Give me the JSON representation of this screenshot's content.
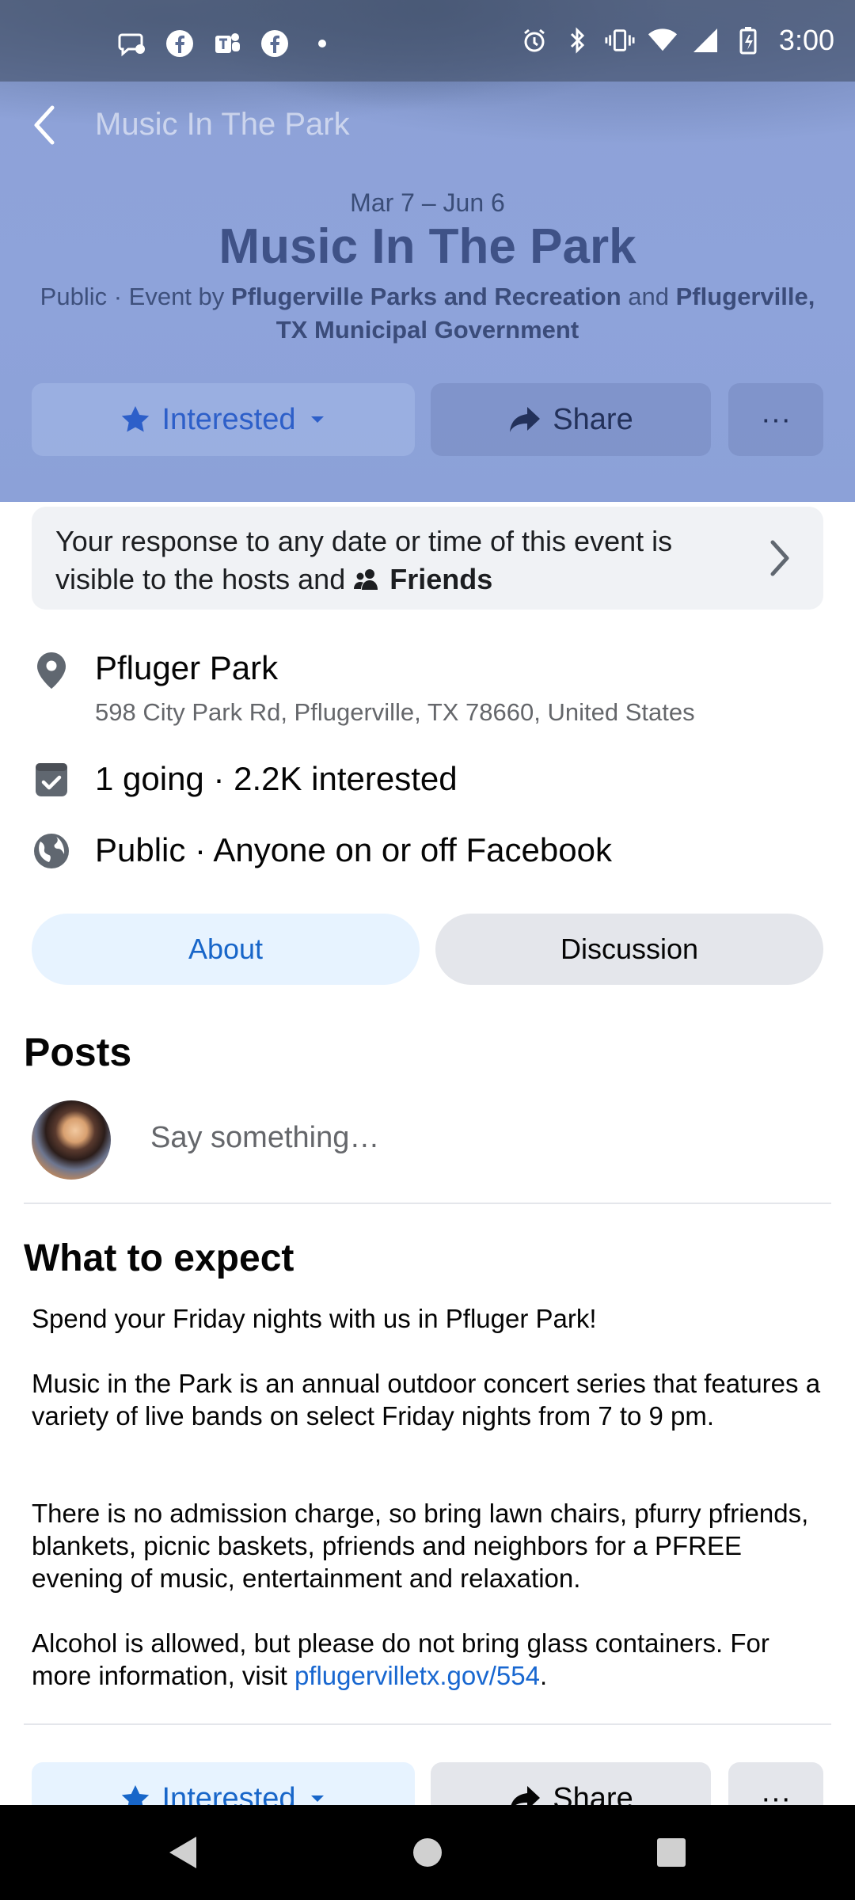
{
  "status_bar": {
    "time": "3:00",
    "left_icons": [
      "messenger-notification-icon",
      "facebook-icon",
      "teams-icon",
      "facebook-icon",
      "dot-icon"
    ],
    "right_icons": [
      "alarm-icon",
      "bluetooth-icon",
      "vibrate-icon",
      "wifi-icon",
      "signal-icon",
      "battery-icon"
    ]
  },
  "header": {
    "top_title": "Music In The Park",
    "dates": "Mar 7 – Jun 6",
    "title": "Music In The Park",
    "hosts_prefix": "Public · Event by ",
    "host1": "Pflugerville Parks and Recreation",
    "hosts_join": " and ",
    "host2": "Pflugerville, TX Municipal Government",
    "buttons": {
      "interested": "Interested",
      "share": "Share",
      "more": "···"
    }
  },
  "privacy_notice": {
    "text": "Your response to any date or time of this event is visible to the hosts and ",
    "audience": "Friends"
  },
  "details": {
    "location_name": "Pfluger Park",
    "location_address": "598 City Park Rd, Pflugerville, TX 78660, United States",
    "attendance": "1 going · 2.2K interested",
    "privacy": "Public · Anyone on or off Facebook"
  },
  "tabs": {
    "about": "About",
    "discussion": "Discussion"
  },
  "posts": {
    "heading": "Posts",
    "composer_placeholder": "Say something…"
  },
  "what_to_expect": {
    "heading": "What to expect",
    "p1": "Spend your Friday nights with us in Pfluger Park!",
    "p2": "Music in the Park is an annual outdoor concert series that features a variety of live bands on select Friday nights from 7 to 9 pm.",
    "p3": "There is no admission charge, so bring lawn chairs, pfurry pfriends, blankets, picnic baskets, pfriends and neighbors for a PFREE evening of music, entertainment and relaxation.",
    "p4_text": "Alcohol is allowed, but please do not bring glass containers. For more information, visit ",
    "p4_link": "pflugervilletx.gov/554",
    "p4_end": "."
  },
  "bottom_buttons": {
    "interested": "Interested",
    "share": "Share",
    "more": "···"
  },
  "colors": {
    "accent": "#1866c9",
    "header_bg": "#8ea3da",
    "title_color": "#3f5287"
  }
}
